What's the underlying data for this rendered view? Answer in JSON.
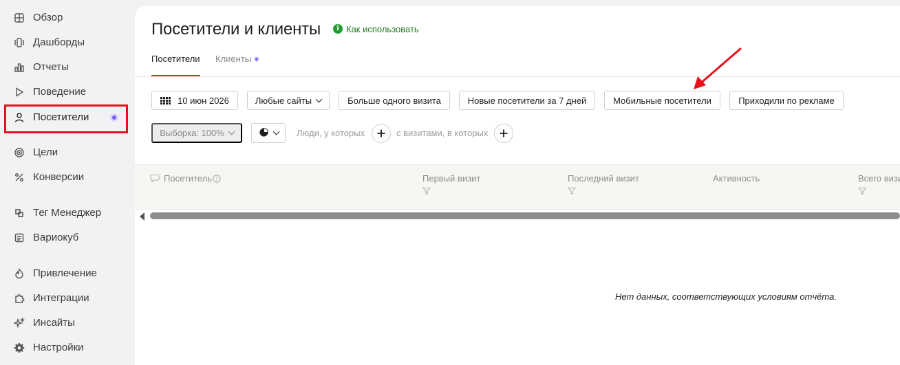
{
  "sidebar": {
    "items": [
      {
        "label": "Обзор",
        "icon": "grid-icon"
      },
      {
        "label": "Дашборды",
        "icon": "dashboards-icon"
      },
      {
        "label": "Отчеты",
        "icon": "bar-chart-icon"
      },
      {
        "label": "Поведение",
        "icon": "play-icon"
      },
      {
        "label": "Посетители",
        "icon": "user-icon",
        "active": true
      },
      {
        "label": "Цели",
        "icon": "target-icon"
      },
      {
        "label": "Конверсии",
        "icon": "percent-icon"
      },
      {
        "label": "Тег Менеджер",
        "icon": "tag-manager-icon"
      },
      {
        "label": "Вариокуб",
        "icon": "variocube-icon"
      },
      {
        "label": "Привлечение",
        "icon": "flame-icon"
      },
      {
        "label": "Интеграции",
        "icon": "puzzle-icon"
      },
      {
        "label": "Инсайты",
        "icon": "sparkle-icon"
      },
      {
        "label": "Настройки",
        "icon": "gear-icon"
      }
    ]
  },
  "header": {
    "title": "Посетители и клиенты",
    "howto_label": "Как использовать"
  },
  "tabs": [
    {
      "label": "Посетители",
      "active": true
    },
    {
      "label": "Клиенты",
      "active": false
    }
  ],
  "filters": {
    "date": "10 июн 2026",
    "sites": "Любые сайты",
    "segments": [
      "Больше одного визита",
      "Новые посетители за 7 дней",
      "Мобильные посетители",
      "Приходили по рекламе"
    ]
  },
  "segmentation": {
    "sample_label": "Выборка: 100%",
    "people_label": "Люди, у которых",
    "visits_label": "с визитами, в которых"
  },
  "table": {
    "columns": [
      "Посетитель",
      "Первый визит",
      "Последний визит",
      "Активность",
      "Всего визи"
    ]
  },
  "empty_state": "Нет данных, соответствующих условиям отчёта.",
  "colors": {
    "accent_red": "#e8101b",
    "tab_underline": "#e6281e",
    "badge_purple": "#7b5cf5",
    "howto_green": "#1f9d2e"
  }
}
